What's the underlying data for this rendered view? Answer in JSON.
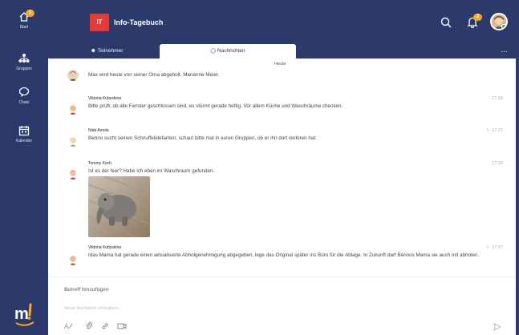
{
  "nav": {
    "start_label": "Start",
    "start_badge": "2",
    "groups_label": "Gruppen",
    "chats_label": "Chats",
    "calendar_label": "Kalender"
  },
  "header": {
    "initials": "IT",
    "title": "Info-Tagebuch",
    "notification_badge": "2"
  },
  "tabs": {
    "participants": "Teilnehmer",
    "messages": "Nachrichten",
    "more": "..."
  },
  "day_label": "Heute",
  "messages": [
    {
      "sender": "",
      "text": "Max wird heute von seiner Oma abgeholt. Marianne Meier.",
      "time": ""
    },
    {
      "sender": "Viktoria Kubyskina",
      "text": "Bitte prüft, ob alle Fenster geschlossen sind, es stürmt gerade heftig. Vor allem Küche und Waschräume checken.",
      "time": "17:18"
    },
    {
      "sender": "Nida Amola",
      "text": "Benno sucht seinen Schnuffelelefanten, schaut bitte mal in euren Gruppen, ob er ihn dort verloren hat.",
      "time": "17:21"
    },
    {
      "sender": "Tommy Koch",
      "text": "Ist es der hier? Habe ich eben im Waschraum gefunden.",
      "time": "17:25"
    },
    {
      "sender": "Viktoria Kubyskina",
      "text": "Idas Mama hat gerade einen aktualisierte Abholgenehmigung abgegeben, lege das Original später ins Büro für die Ablage. In Zukunft darf Bennos Mama sie auch mit abholen.",
      "time": "17:27"
    }
  ],
  "compose": {
    "subject_placeholder": "Betreff hinzufügen",
    "body_placeholder": "Neue Nachricht schreiben..."
  },
  "colors": {
    "nav_bg": "#2b3a6b",
    "badge": "#f5a623",
    "accent_red": "#e53935",
    "online": "#43a047"
  }
}
